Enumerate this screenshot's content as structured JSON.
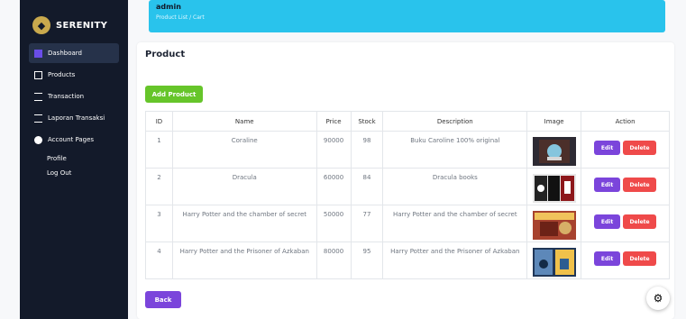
{
  "sidebar": {
    "brand": "SERENITY",
    "items": [
      {
        "label": "Dashboard"
      },
      {
        "label": "Products"
      },
      {
        "label": "Transaction"
      },
      {
        "label": "Laporan Transaksi"
      },
      {
        "label": "Account Pages"
      }
    ],
    "account_sub": [
      "Profile",
      "Log Out"
    ]
  },
  "topbar": {
    "user": "admin",
    "breadcrumb": "Product List / Cart"
  },
  "page": {
    "title": "Product",
    "add_button": "Add Product",
    "back_button": "Back"
  },
  "table": {
    "headers": [
      "ID",
      "Name",
      "Price",
      "Stock",
      "Description",
      "Image",
      "Action"
    ],
    "rows": [
      {
        "id": "1",
        "name": "Coraline",
        "price": "90000",
        "stock": "98",
        "description": "Buku Caroline 100% original"
      },
      {
        "id": "2",
        "name": "Dracula",
        "price": "60000",
        "stock": "84",
        "description": "Dracula books"
      },
      {
        "id": "3",
        "name": "Harry Potter and the chamber of secret",
        "price": "50000",
        "stock": "77",
        "description": "Harry Potter and the chamber of secret"
      },
      {
        "id": "4",
        "name": "Harry Potter and the Prisoner of Azkaban",
        "price": "80000",
        "stock": "95",
        "description": "Harry Potter and the Prisoner of Azkaban"
      }
    ],
    "edit_label": "Edit",
    "delete_label": "Delete"
  }
}
